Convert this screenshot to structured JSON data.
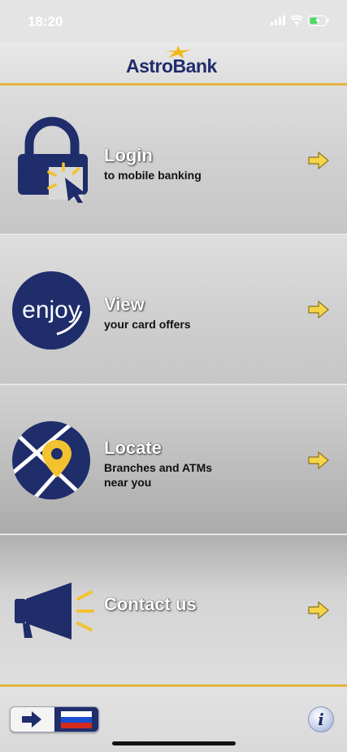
{
  "status": {
    "time": "18:20"
  },
  "header": {
    "brand": "AstroBank"
  },
  "menu": [
    {
      "title": "Login",
      "subtitle": [
        "to mobile banking"
      ],
      "icon": "lock-icon"
    },
    {
      "title": "View",
      "subtitle": [
        "your card offers"
      ],
      "icon": "enjoy-logo-icon",
      "badge_text": "enjoy"
    },
    {
      "title": "Locate",
      "subtitle": [
        "Branches and ATMs",
        "near you"
      ],
      "icon": "map-pin-icon"
    },
    {
      "title": "Contact us",
      "subtitle": [],
      "icon": "megaphone-icon"
    }
  ],
  "footer": {
    "info_label": "i",
    "language": "ru"
  },
  "colors": {
    "navy": "#1f2d6b",
    "gold": "#e3b440",
    "arrow": "#f5d547"
  }
}
